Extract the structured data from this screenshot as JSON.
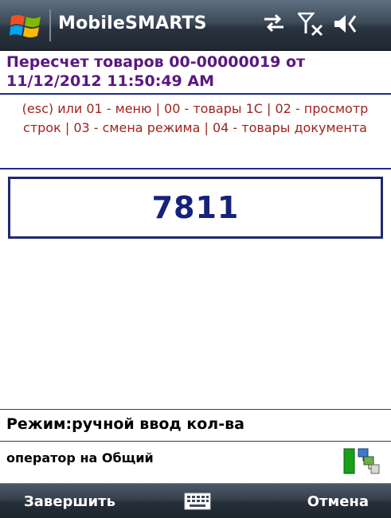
{
  "titlebar": {
    "app_title": "MobileSMARTS",
    "icons": [
      "windows-start-icon",
      "connectivity-icon",
      "signal-no-service-icon",
      "volume-icon"
    ]
  },
  "document": {
    "title": "Пересчет товаров 00-00000019 от 11/12/2012 11:50:49 AM",
    "hint": "(esc) или 01 - меню | 00 - товары 1С | 02 - просмотр строк | 03 - смена режима | 04 - товары документа"
  },
  "input": {
    "value": "7811"
  },
  "status": {
    "mode": "Режим:ручной ввод кол-ва",
    "operator": "оператор на Общий"
  },
  "menubar": {
    "left_label": "Завершить",
    "right_label": "Отмена",
    "center_icon": "keyboard-icon"
  },
  "colors": {
    "title_color": "#5a1780",
    "hint_color": "#a0241c",
    "input_color": "#16227a",
    "divider_color": "#1c2c8a"
  }
}
